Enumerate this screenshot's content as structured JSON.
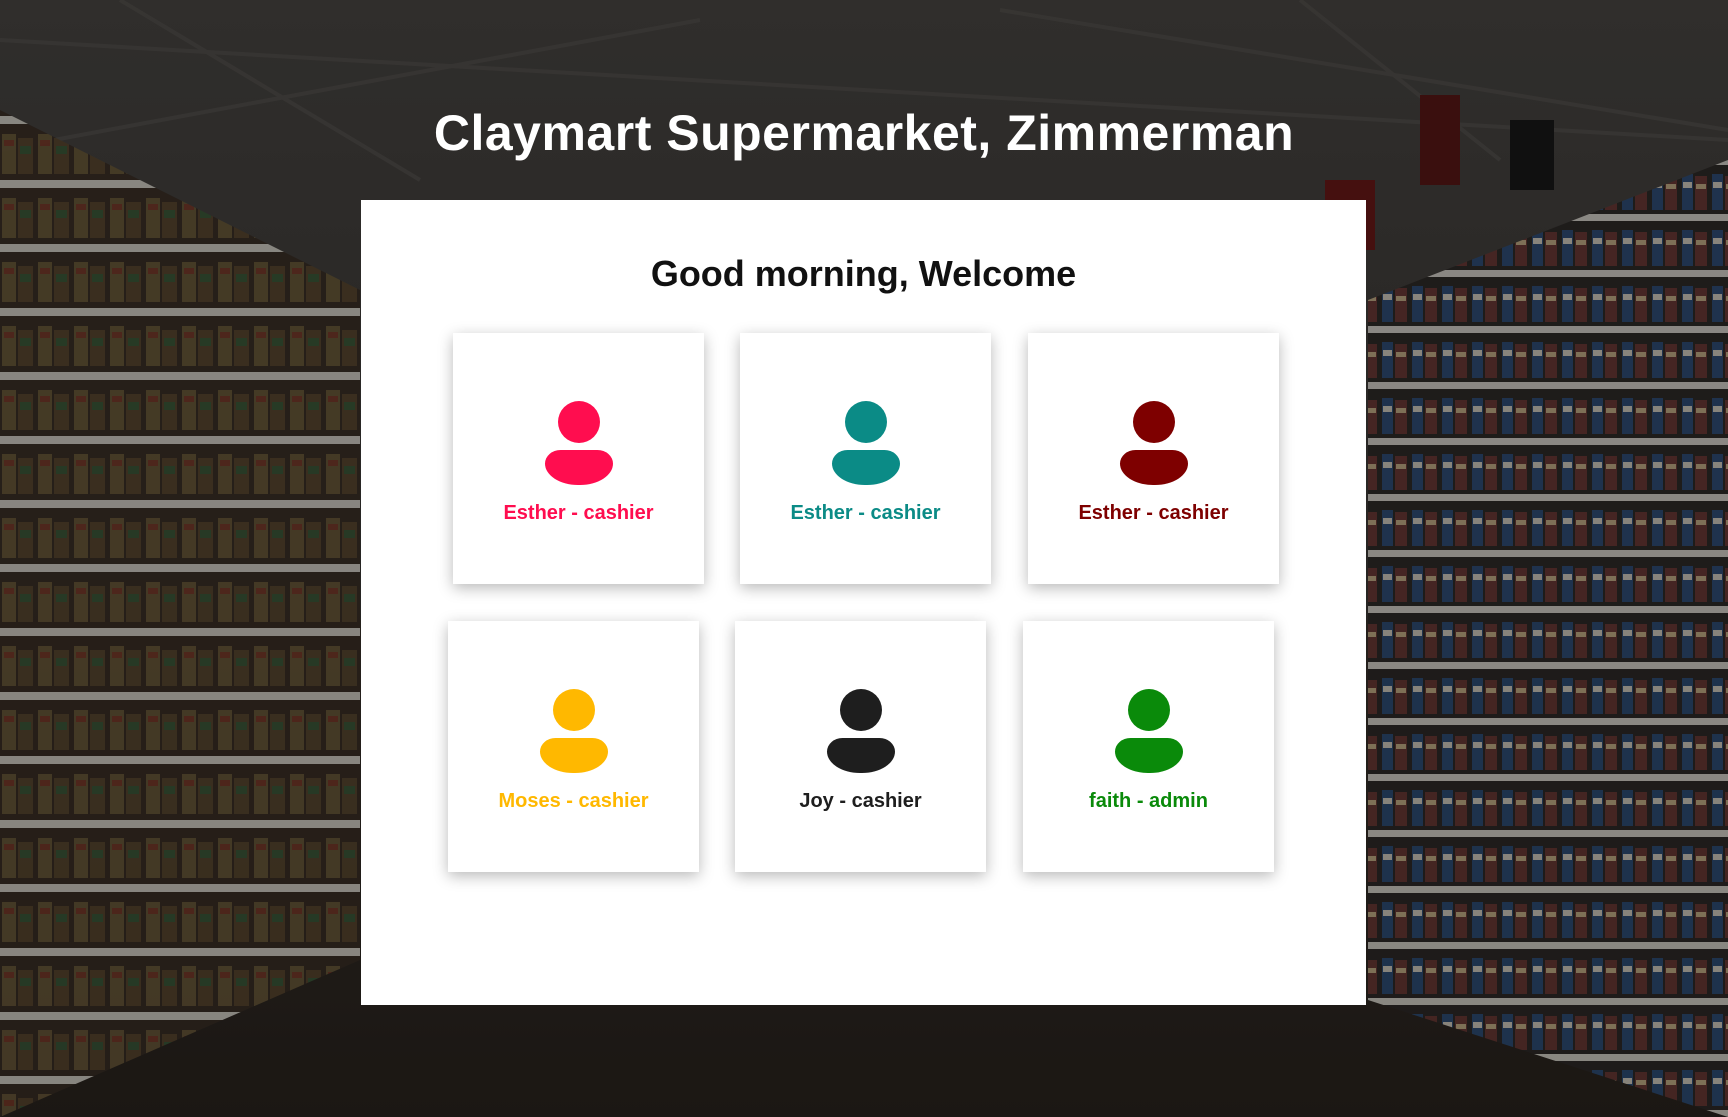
{
  "store_title": "Claymart Supermarket, Zimmerman",
  "greeting": "Good morning, Welcome",
  "users": [
    {
      "label": "Esther - cashier",
      "color": "#ff0d4f"
    },
    {
      "label": "Esther - cashier",
      "color": "#0b8b86"
    },
    {
      "label": "Esther - cashier",
      "color": "#7e0000"
    },
    {
      "label": "Moses - cashier",
      "color": "#ffb800"
    },
    {
      "label": "Joy - cashier",
      "color": "#1e1e1e"
    },
    {
      "label": "faith - admin",
      "color": "#0a8a0a"
    }
  ]
}
